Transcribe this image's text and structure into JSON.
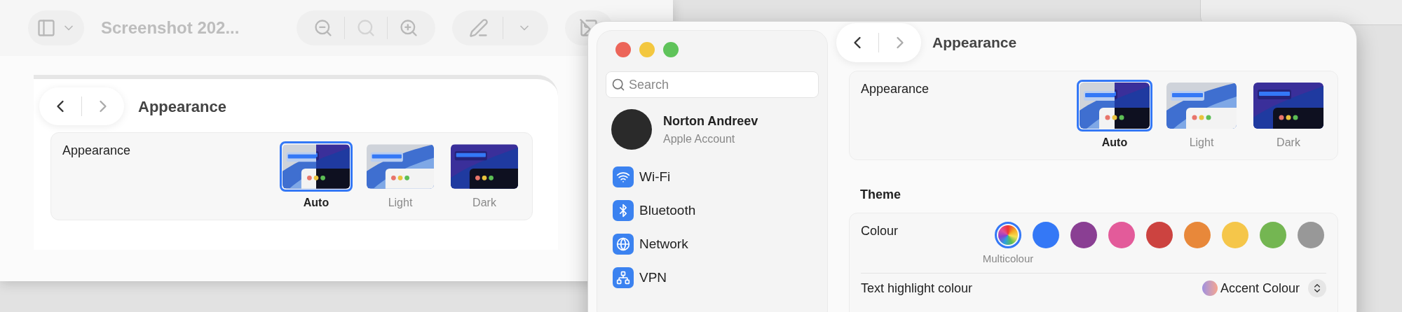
{
  "preview_window": {
    "title": "Screenshot 202...",
    "embedded_page": {
      "title": "Appearance",
      "appearance_label": "Appearance",
      "options": [
        {
          "label": "Auto",
          "kind": "auto",
          "selected": true
        },
        {
          "label": "Light",
          "kind": "light",
          "selected": false
        },
        {
          "label": "Dark",
          "kind": "dark",
          "selected": false
        }
      ]
    }
  },
  "settings_window": {
    "search": {
      "placeholder": "Search"
    },
    "account": {
      "name": "Norton Andreev",
      "subtitle": "Apple Account"
    },
    "sidebar_items": [
      {
        "label": "Wi-Fi",
        "kind": "wifi"
      },
      {
        "label": "Bluetooth",
        "kind": "bluetooth"
      },
      {
        "label": "Network",
        "kind": "network"
      },
      {
        "label": "VPN",
        "kind": "vpn"
      }
    ],
    "title": "Appearance",
    "appearance": {
      "label": "Appearance",
      "options": [
        {
          "label": "Auto",
          "kind": "auto",
          "selected": true
        },
        {
          "label": "Light",
          "kind": "light",
          "selected": false
        },
        {
          "label": "Dark",
          "kind": "dark",
          "selected": false
        }
      ]
    },
    "theme": {
      "heading": "Theme",
      "colour_label": "Colour",
      "colours": [
        {
          "kind": "multi",
          "label": "Multicolour",
          "selected": true
        },
        {
          "kind": "solid",
          "color": "#3478f6",
          "selected": false
        },
        {
          "kind": "solid",
          "color": "#8a3f93",
          "selected": false
        },
        {
          "kind": "solid",
          "color": "#e35b9a",
          "selected": false
        },
        {
          "kind": "solid",
          "color": "#cc4340",
          "selected": false
        },
        {
          "kind": "solid",
          "color": "#e8883a",
          "selected": false
        },
        {
          "kind": "solid",
          "color": "#f5c64a",
          "selected": false
        },
        {
          "kind": "solid",
          "color": "#74b652",
          "selected": false
        },
        {
          "kind": "solid",
          "color": "#989898",
          "selected": false
        }
      ],
      "highlight": {
        "label": "Text highlight colour",
        "value": "Accent Colour"
      }
    }
  }
}
